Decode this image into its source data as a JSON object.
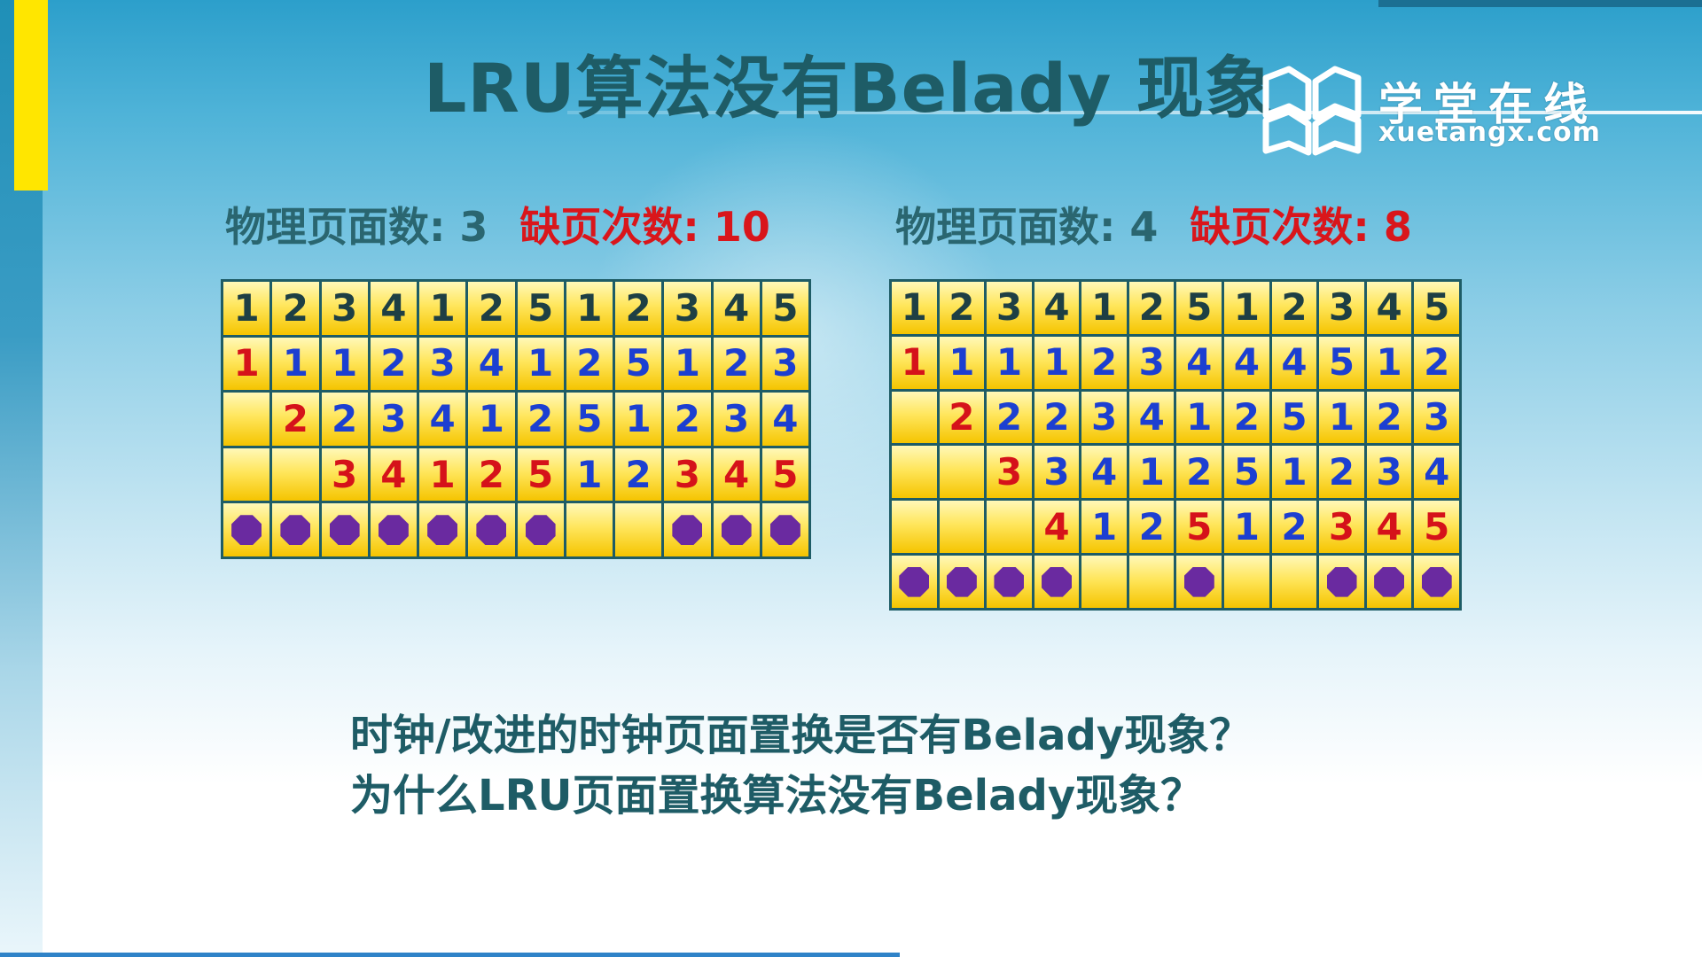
{
  "slide": {
    "title": "LRU算法没有Belady 现象",
    "logo": {
      "name": "学堂在线",
      "url": "xuetangx.com"
    }
  },
  "left": {
    "frames_label": "物理页面数: 3",
    "faults_label": "缺页次数: 10",
    "reference": [
      "1",
      "2",
      "3",
      "4",
      "1",
      "2",
      "5",
      "1",
      "2",
      "3",
      "4",
      "5"
    ],
    "rows": [
      [
        "1",
        "1",
        "1",
        "2",
        "3",
        "4",
        "1",
        "2",
        "5",
        "1",
        "2",
        "3"
      ],
      [
        "",
        "2",
        "2",
        "3",
        "4",
        "1",
        "2",
        "5",
        "1",
        "2",
        "3",
        "4"
      ],
      [
        "",
        "",
        "3",
        "4",
        "1",
        "2",
        "5",
        "1",
        "2",
        "3",
        "4",
        "5"
      ]
    ],
    "new_flags": [
      [
        1,
        0,
        0,
        0,
        0,
        0,
        0,
        0,
        0,
        0,
        0,
        0
      ],
      [
        0,
        1,
        0,
        0,
        0,
        0,
        0,
        0,
        0,
        0,
        0,
        0
      ],
      [
        0,
        0,
        1,
        1,
        1,
        1,
        1,
        0,
        0,
        1,
        1,
        1
      ]
    ],
    "faults": [
      1,
      1,
      1,
      1,
      1,
      1,
      1,
      0,
      0,
      1,
      1,
      1
    ]
  },
  "right": {
    "frames_label": "物理页面数: 4",
    "faults_label": "缺页次数: 8",
    "reference": [
      "1",
      "2",
      "3",
      "4",
      "1",
      "2",
      "5",
      "1",
      "2",
      "3",
      "4",
      "5"
    ],
    "rows": [
      [
        "1",
        "1",
        "1",
        "1",
        "2",
        "3",
        "4",
        "4",
        "4",
        "5",
        "1",
        "2"
      ],
      [
        "",
        "2",
        "2",
        "2",
        "3",
        "4",
        "1",
        "2",
        "5",
        "1",
        "2",
        "3"
      ],
      [
        "",
        "",
        "3",
        "3",
        "4",
        "1",
        "2",
        "5",
        "1",
        "2",
        "3",
        "4"
      ],
      [
        "",
        "",
        "",
        "4",
        "1",
        "2",
        "5",
        "1",
        "2",
        "3",
        "4",
        "5"
      ]
    ],
    "new_flags": [
      [
        1,
        0,
        0,
        0,
        0,
        0,
        0,
        0,
        0,
        0,
        0,
        0
      ],
      [
        0,
        1,
        0,
        0,
        0,
        0,
        0,
        0,
        0,
        0,
        0,
        0
      ],
      [
        0,
        0,
        1,
        0,
        0,
        0,
        0,
        0,
        0,
        0,
        0,
        0
      ],
      [
        0,
        0,
        0,
        1,
        0,
        0,
        1,
        0,
        0,
        1,
        1,
        1
      ]
    ],
    "faults": [
      1,
      1,
      1,
      1,
      0,
      0,
      1,
      0,
      0,
      1,
      1,
      1
    ]
  },
  "questions": [
    "时钟/改进的时钟页面置换是否有Belady现象？",
    "为什么LRU页面置换算法没有Belady现象？"
  ],
  "colors": {
    "title": "#1e5c66",
    "fault_count": "#d9161b",
    "new_page": "#d5121a",
    "existing_page": "#1c3fd1",
    "fault_marker": "#6a2aa0",
    "cell_fill": "#ffe65c"
  },
  "icons": {
    "logo": "open-book-icon",
    "fault_marker": "octagon-fault-icon"
  }
}
